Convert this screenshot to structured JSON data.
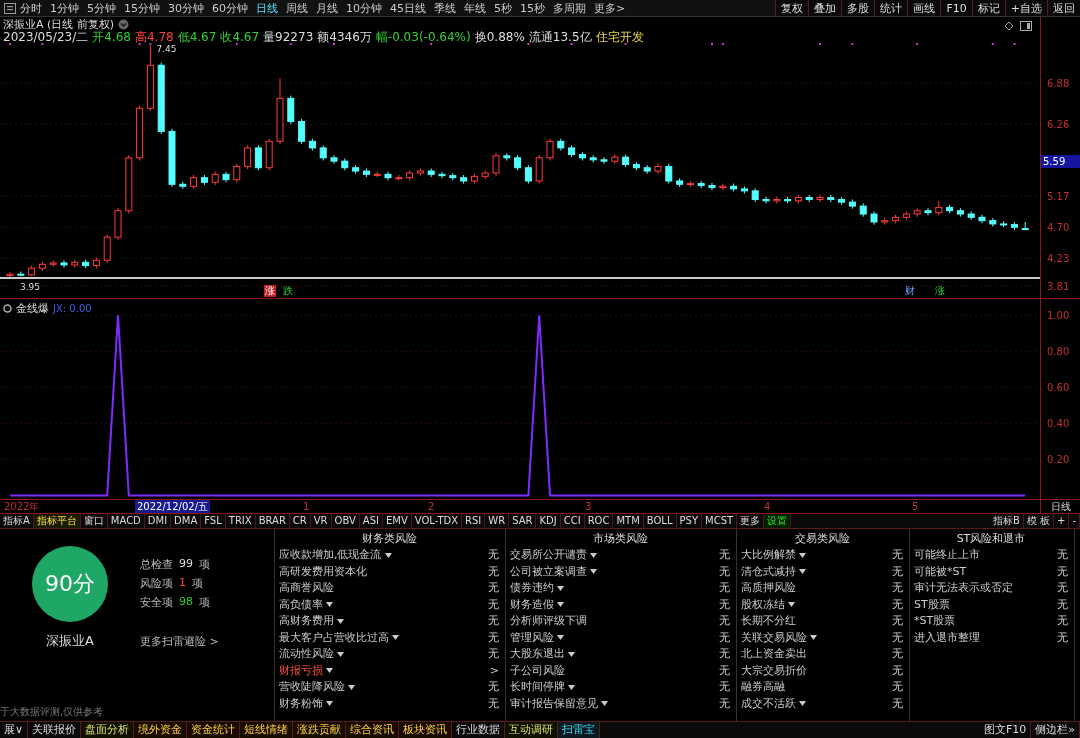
{
  "toolbar": {
    "periods": [
      {
        "label": "分时",
        "selected": false
      },
      {
        "label": "1分钟",
        "selected": false
      },
      {
        "label": "5分钟",
        "selected": false
      },
      {
        "label": "15分钟",
        "selected": false
      },
      {
        "label": "30分钟",
        "selected": false
      },
      {
        "label": "60分钟",
        "selected": false
      },
      {
        "label": "日线",
        "selected": true
      },
      {
        "label": "周线",
        "selected": false
      },
      {
        "label": "月线",
        "selected": false
      },
      {
        "label": "10分钟",
        "selected": false
      },
      {
        "label": "45日线",
        "selected": false
      },
      {
        "label": "季线",
        "selected": false
      },
      {
        "label": "年线",
        "selected": false
      },
      {
        "label": "5秒",
        "selected": false
      },
      {
        "label": "15秒",
        "selected": false
      },
      {
        "label": "多周期",
        "selected": false
      },
      {
        "label": "更多>",
        "selected": false
      }
    ],
    "buttons": [
      "复权",
      "叠加",
      "多股",
      "统计",
      "画线",
      "F10",
      "标记",
      "+自选",
      "返回"
    ]
  },
  "price_chart": {
    "title": "深振业A (日线 前复权)",
    "quote": [
      {
        "text": "2023/05/23/二",
        "color": "#dddddd"
      },
      {
        "text": "开4.68",
        "color": "#30d030"
      },
      {
        "text": "高4.78",
        "color": "#ff4040"
      },
      {
        "text": "低4.67",
        "color": "#30d030"
      },
      {
        "text": "收4.67",
        "color": "#30d030"
      },
      {
        "text": "量92273",
        "color": "#dddddd"
      },
      {
        "text": "额4346万",
        "color": "#dddddd"
      },
      {
        "text": "幅-0.03(-0.64%)",
        "color": "#30d030"
      },
      {
        "text": "换0.88%",
        "color": "#dddddd"
      },
      {
        "text": "流通13.5亿",
        "color": "#dddddd"
      },
      {
        "text": "住宅开发",
        "color": "#e8d44d"
      }
    ],
    "chart_data": {
      "type": "candlestick",
      "grid": true,
      "ylim": [
        3.63,
        7.88
      ],
      "yticks": [
        {
          "value": 3.81,
          "label": "3.81"
        },
        {
          "value": 4.23,
          "label": "4.23"
        },
        {
          "value": 4.7,
          "label": "4.70"
        },
        {
          "value": 5.17,
          "label": "5.17"
        },
        {
          "value": 6.26,
          "label": "6.26"
        },
        {
          "value": 6.88,
          "label": "6.88"
        }
      ],
      "ohlc": [
        [
          3.97,
          4.02,
          3.95,
          3.99
        ],
        [
          3.99,
          4.03,
          3.96,
          3.98
        ],
        [
          3.98,
          4.12,
          3.96,
          4.08
        ],
        [
          4.08,
          4.18,
          4.04,
          4.14
        ],
        [
          4.14,
          4.2,
          4.1,
          4.16
        ],
        [
          4.16,
          4.2,
          4.09,
          4.13
        ],
        [
          4.13,
          4.21,
          4.09,
          4.17
        ],
        [
          4.17,
          4.21,
          4.08,
          4.12
        ],
        [
          4.12,
          4.24,
          4.08,
          4.2
        ],
        [
          4.2,
          4.59,
          4.16,
          4.55
        ],
        [
          4.55,
          4.99,
          4.51,
          4.95
        ],
        [
          4.95,
          5.79,
          4.91,
          5.75
        ],
        [
          5.75,
          6.54,
          5.71,
          6.5
        ],
        [
          6.5,
          7.45,
          6.46,
          7.15
        ],
        [
          7.15,
          7.19,
          6.11,
          6.15
        ],
        [
          6.15,
          6.19,
          5.31,
          5.35
        ],
        [
          5.35,
          5.39,
          5.28,
          5.32
        ],
        [
          5.32,
          5.49,
          5.28,
          5.45
        ],
        [
          5.45,
          5.49,
          5.34,
          5.38
        ],
        [
          5.38,
          5.54,
          5.34,
          5.5
        ],
        [
          5.5,
          5.54,
          5.38,
          5.42
        ],
        [
          5.42,
          5.66,
          5.38,
          5.62
        ],
        [
          5.62,
          5.94,
          5.58,
          5.9
        ],
        [
          5.9,
          5.94,
          5.56,
          5.6
        ],
        [
          5.6,
          6.04,
          5.56,
          6.0
        ],
        [
          6.0,
          6.95,
          5.96,
          6.65
        ],
        [
          6.65,
          6.69,
          6.26,
          6.3
        ],
        [
          6.3,
          6.34,
          5.96,
          6.0
        ],
        [
          6.0,
          6.04,
          5.86,
          5.9
        ],
        [
          5.9,
          5.94,
          5.71,
          5.75
        ],
        [
          5.75,
          5.79,
          5.66,
          5.7
        ],
        [
          5.7,
          5.74,
          5.56,
          5.6
        ],
        [
          5.6,
          5.64,
          5.51,
          5.55
        ],
        [
          5.55,
          5.59,
          5.46,
          5.5
        ],
        [
          5.5,
          5.54,
          5.46,
          5.5
        ],
        [
          5.5,
          5.54,
          5.41,
          5.45
        ],
        [
          5.45,
          5.49,
          5.41,
          5.45
        ],
        [
          5.45,
          5.56,
          5.41,
          5.52
        ],
        [
          5.52,
          5.59,
          5.48,
          5.55
        ],
        [
          5.55,
          5.59,
          5.46,
          5.5
        ],
        [
          5.5,
          5.54,
          5.44,
          5.48
        ],
        [
          5.48,
          5.52,
          5.41,
          5.45
        ],
        [
          5.45,
          5.49,
          5.36,
          5.4
        ],
        [
          5.4,
          5.51,
          5.36,
          5.47
        ],
        [
          5.47,
          5.56,
          5.43,
          5.52
        ],
        [
          5.52,
          5.82,
          5.48,
          5.78
        ],
        [
          5.78,
          5.82,
          5.71,
          5.75
        ],
        [
          5.75,
          5.79,
          5.56,
          5.6
        ],
        [
          5.6,
          5.64,
          5.36,
          5.4
        ],
        [
          5.4,
          5.79,
          5.36,
          5.75
        ],
        [
          5.75,
          6.04,
          5.71,
          6.0
        ],
        [
          6.0,
          6.04,
          5.86,
          5.9
        ],
        [
          5.9,
          5.94,
          5.76,
          5.8
        ],
        [
          5.8,
          5.84,
          5.71,
          5.75
        ],
        [
          5.75,
          5.79,
          5.68,
          5.72
        ],
        [
          5.72,
          5.76,
          5.66,
          5.7
        ],
        [
          5.7,
          5.8,
          5.66,
          5.76
        ],
        [
          5.76,
          5.8,
          5.61,
          5.65
        ],
        [
          5.65,
          5.69,
          5.56,
          5.6
        ],
        [
          5.6,
          5.64,
          5.51,
          5.55
        ],
        [
          5.55,
          5.66,
          5.51,
          5.62
        ],
        [
          5.62,
          5.66,
          5.36,
          5.4
        ],
        [
          5.4,
          5.44,
          5.31,
          5.35
        ],
        [
          5.35,
          5.4,
          5.31,
          5.36
        ],
        [
          5.36,
          5.4,
          5.29,
          5.33
        ],
        [
          5.33,
          5.37,
          5.26,
          5.3
        ],
        [
          5.3,
          5.36,
          5.26,
          5.32
        ],
        [
          5.32,
          5.36,
          5.24,
          5.28
        ],
        [
          5.28,
          5.32,
          5.21,
          5.25
        ],
        [
          5.25,
          5.29,
          5.08,
          5.12
        ],
        [
          5.12,
          5.16,
          5.06,
          5.1
        ],
        [
          5.1,
          5.16,
          5.06,
          5.12
        ],
        [
          5.12,
          5.16,
          5.06,
          5.1
        ],
        [
          5.1,
          5.19,
          5.06,
          5.15
        ],
        [
          5.15,
          5.19,
          5.08,
          5.12
        ],
        [
          5.12,
          5.19,
          5.08,
          5.15
        ],
        [
          5.15,
          5.19,
          5.08,
          5.12
        ],
        [
          5.12,
          5.16,
          5.04,
          5.08
        ],
        [
          5.08,
          5.12,
          4.98,
          5.02
        ],
        [
          5.02,
          5.06,
          4.86,
          4.9
        ],
        [
          4.9,
          4.94,
          4.74,
          4.78
        ],
        [
          4.78,
          4.84,
          4.74,
          4.8
        ],
        [
          4.8,
          4.89,
          4.76,
          4.85
        ],
        [
          4.85,
          4.94,
          4.81,
          4.9
        ],
        [
          4.9,
          4.99,
          4.86,
          4.95
        ],
        [
          4.95,
          4.99,
          4.88,
          4.92
        ],
        [
          4.92,
          5.1,
          4.88,
          5.0
        ],
        [
          5.0,
          5.04,
          4.91,
          4.95
        ],
        [
          4.95,
          4.99,
          4.86,
          4.9
        ],
        [
          4.9,
          4.94,
          4.81,
          4.85
        ],
        [
          4.85,
          4.89,
          4.76,
          4.8
        ],
        [
          4.8,
          4.84,
          4.71,
          4.75
        ],
        [
          4.75,
          4.79,
          4.7,
          4.74
        ],
        [
          4.74,
          4.78,
          4.66,
          4.7
        ],
        [
          4.68,
          4.78,
          4.67,
          4.67
        ]
      ],
      "annotations": [
        "7.45",
        "3.95"
      ]
    },
    "last_price": "5.59",
    "event_tags": [
      {
        "label": "涨",
        "kind": "up"
      },
      {
        "label": "跌",
        "kind": "down"
      },
      {
        "label": "财",
        "kind": "info"
      },
      {
        "label": "涨",
        "kind": "down"
      }
    ]
  },
  "indicator": {
    "title": "金线爆",
    "reading": "JX: 0.00",
    "chart_data": {
      "type": "line",
      "grid": true,
      "ylim": [
        -0.02,
        1.09
      ],
      "yticks": [
        {
          "value": 0.2,
          "label": "0.20"
        },
        {
          "value": 0.4,
          "label": "0.40"
        },
        {
          "value": 0.6,
          "label": "0.60"
        },
        {
          "value": 0.8,
          "label": "0.80"
        },
        {
          "value": 1.0,
          "label": "1.00"
        }
      ],
      "series": [
        {
          "color": "#7b2cff",
          "values": [
            0,
            0,
            0,
            0,
            0,
            0,
            0,
            0,
            0,
            0,
            1,
            0,
            0,
            0,
            0,
            0,
            0,
            0,
            0,
            0,
            0,
            0,
            0,
            0,
            0,
            0,
            0,
            0,
            0,
            0,
            0,
            0,
            0,
            0,
            0,
            0,
            0,
            0,
            0,
            0,
            0,
            0,
            0,
            0,
            0,
            0,
            0,
            0,
            0,
            1,
            0,
            0,
            0,
            0,
            0,
            0,
            0,
            0,
            0,
            0,
            0,
            0,
            0,
            0,
            0,
            0,
            0,
            0,
            0,
            0,
            0,
            0,
            0,
            0,
            0,
            0,
            0,
            0,
            0,
            0,
            0,
            0,
            0,
            0,
            0,
            0,
            0,
            0,
            0,
            0,
            0,
            0,
            0,
            0,
            0
          ]
        }
      ]
    }
  },
  "date_axis": {
    "labels": [
      "2022年",
      "1",
      "2",
      "3",
      "4",
      "5"
    ],
    "cursor_date": "2022/12/02/五",
    "period_label": "日线"
  },
  "indicator_tabs": [
    {
      "label": "指标A",
      "kind": "plain"
    },
    {
      "label": "指标平台",
      "kind": "highlight"
    },
    {
      "label": "窗口",
      "kind": "plain"
    },
    {
      "label": "MACD",
      "kind": "plain"
    },
    {
      "label": "DMI",
      "kind": "plain"
    },
    {
      "label": "DMA",
      "kind": "plain"
    },
    {
      "label": "FSL",
      "kind": "plain"
    },
    {
      "label": "TRIX",
      "kind": "plain"
    },
    {
      "label": "BRAR",
      "kind": "plain"
    },
    {
      "label": "CR",
      "kind": "plain"
    },
    {
      "label": "VR",
      "kind": "plain"
    },
    {
      "label": "OBV",
      "kind": "plain"
    },
    {
      "label": "ASI",
      "kind": "plain"
    },
    {
      "label": "EMV",
      "kind": "plain"
    },
    {
      "label": "VOL-TDX",
      "kind": "plain"
    },
    {
      "label": "RSI",
      "kind": "plain"
    },
    {
      "label": "WR",
      "kind": "plain"
    },
    {
      "label": "SAR",
      "kind": "plain"
    },
    {
      "label": "KDJ",
      "kind": "plain"
    },
    {
      "label": "CCI",
      "kind": "plain"
    },
    {
      "label": "ROC",
      "kind": "plain"
    },
    {
      "label": "MTM",
      "kind": "plain"
    },
    {
      "label": "BOLL",
      "kind": "plain"
    },
    {
      "label": "PSY",
      "kind": "plain"
    },
    {
      "label": "MCST",
      "kind": "plain"
    },
    {
      "label": "更多",
      "kind": "plain"
    },
    {
      "label": "设置",
      "kind": "action"
    }
  ],
  "indicator_tabs_right": [
    "指标B",
    "模 板",
    "+",
    "-"
  ],
  "risk": {
    "score": "90分",
    "stock": "深振业A",
    "stats": [
      {
        "label": "总检查",
        "count": "99",
        "unit": "项",
        "color": "#dddddd"
      },
      {
        "label": "风险项",
        "count": "1",
        "unit": "项",
        "color": "#ff4040"
      },
      {
        "label": "安全项",
        "count": "98",
        "unit": "项",
        "color": "#30d030"
      }
    ],
    "more_link": "更多扫雷避险 >",
    "note": "于大数据评测,仅供参考",
    "columns": [
      {
        "title": "财务类风险",
        "items": [
          {
            "label": "应收款增加,低现金流",
            "has_menu": true,
            "alert": false,
            "value": "无"
          },
          {
            "label": "高研发费用资本化",
            "has_menu": false,
            "alert": false,
            "value": "无"
          },
          {
            "label": "高商誉风险",
            "has_menu": false,
            "alert": false,
            "value": "无"
          },
          {
            "label": "高负债率",
            "has_menu": true,
            "alert": false,
            "value": "无"
          },
          {
            "label": "高财务费用",
            "has_menu": true,
            "alert": false,
            "value": "无"
          },
          {
            "label": "最大客户占营收比过高",
            "has_menu": true,
            "alert": false,
            "value": "无"
          },
          {
            "label": "流动性风险",
            "has_menu": true,
            "alert": false,
            "value": "无"
          },
          {
            "label": "财报亏损",
            "has_menu": true,
            "alert": true,
            "value": ">"
          },
          {
            "label": "营收陡降风险",
            "has_menu": true,
            "alert": false,
            "value": "无"
          },
          {
            "label": "财务粉饰",
            "has_menu": true,
            "alert": false,
            "value": "无"
          }
        ]
      },
      {
        "title": "市场类风险",
        "items": [
          {
            "label": "交易所公开谴责",
            "has_menu": true,
            "alert": false,
            "value": "无"
          },
          {
            "label": "公司被立案调查",
            "has_menu": true,
            "alert": false,
            "value": "无"
          },
          {
            "label": "债券违约",
            "has_menu": true,
            "alert": false,
            "value": "无"
          },
          {
            "label": "财务造假",
            "has_menu": true,
            "alert": false,
            "value": "无"
          },
          {
            "label": "分析师评级下调",
            "has_menu": false,
            "alert": false,
            "value": "无"
          },
          {
            "label": "管理风险",
            "has_menu": true,
            "alert": false,
            "value": "无"
          },
          {
            "label": "大股东退出",
            "has_menu": true,
            "alert": false,
            "value": "无"
          },
          {
            "label": "子公司风险",
            "has_menu": false,
            "alert": false,
            "value": "无"
          },
          {
            "label": "长时间停牌",
            "has_menu": true,
            "alert": false,
            "value": "无"
          },
          {
            "label": "审计报告保留意见",
            "has_menu": true,
            "alert": false,
            "value": "无"
          }
        ]
      },
      {
        "title": "交易类风险",
        "items": [
          {
            "label": "大比例解禁",
            "has_menu": true,
            "alert": false,
            "value": "无"
          },
          {
            "label": "清仓式减持",
            "has_menu": true,
            "alert": false,
            "value": "无"
          },
          {
            "label": "高质押风险",
            "has_menu": false,
            "alert": false,
            "value": "无"
          },
          {
            "label": "股权冻结",
            "has_menu": true,
            "alert": false,
            "value": "无"
          },
          {
            "label": "长期不分红",
            "has_menu": false,
            "alert": false,
            "value": "无"
          },
          {
            "label": "关联交易风险",
            "has_menu": true,
            "alert": false,
            "value": "无"
          },
          {
            "label": "北上资金卖出",
            "has_menu": false,
            "alert": false,
            "value": "无"
          },
          {
            "label": "大宗交易折价",
            "has_menu": false,
            "alert": false,
            "value": "无"
          },
          {
            "label": "融券高融",
            "has_menu": false,
            "alert": false,
            "value": "无"
          },
          {
            "label": "成交不活跃",
            "has_menu": true,
            "alert": false,
            "value": "无"
          }
        ]
      },
      {
        "title": "ST风险和退市",
        "items": [
          {
            "label": "可能终止上市",
            "has_menu": false,
            "alert": false,
            "value": "无"
          },
          {
            "label": "可能被*ST",
            "has_menu": false,
            "alert": false,
            "value": "无"
          },
          {
            "label": "审计无法表示或否定",
            "has_menu": false,
            "alert": false,
            "value": "无"
          },
          {
            "label": "ST股票",
            "has_menu": false,
            "alert": false,
            "value": "无"
          },
          {
            "label": "*ST股票",
            "has_menu": false,
            "alert": false,
            "value": "无"
          },
          {
            "label": "进入退市整理",
            "has_menu": false,
            "alert": false,
            "value": "无"
          }
        ]
      }
    ]
  },
  "bottom_tabs": [
    {
      "label": "展∨",
      "kind": "plain",
      "selected": false
    },
    {
      "label": "关联报价",
      "kind": "plain",
      "selected": false
    },
    {
      "label": "盘面分析",
      "kind": "analysis",
      "selected": false
    },
    {
      "label": "境外资金",
      "kind": "data",
      "selected": false
    },
    {
      "label": "资金统计",
      "kind": "data",
      "selected": false
    },
    {
      "label": "短线情绪",
      "kind": "data",
      "selected": false
    },
    {
      "label": "涨跌贡献",
      "kind": "data",
      "selected": false
    },
    {
      "label": "综合资讯",
      "kind": "data",
      "selected": false
    },
    {
      "label": "板块资讯",
      "kind": "data",
      "selected": false
    },
    {
      "label": "行业数据",
      "kind": "plain",
      "selected": false
    },
    {
      "label": "互动调研",
      "kind": "analysis",
      "selected": false
    },
    {
      "label": "扫雷宝",
      "kind": "plain",
      "selected": true
    }
  ],
  "bottom_right": [
    "图文F10",
    "侧边栏»"
  ]
}
